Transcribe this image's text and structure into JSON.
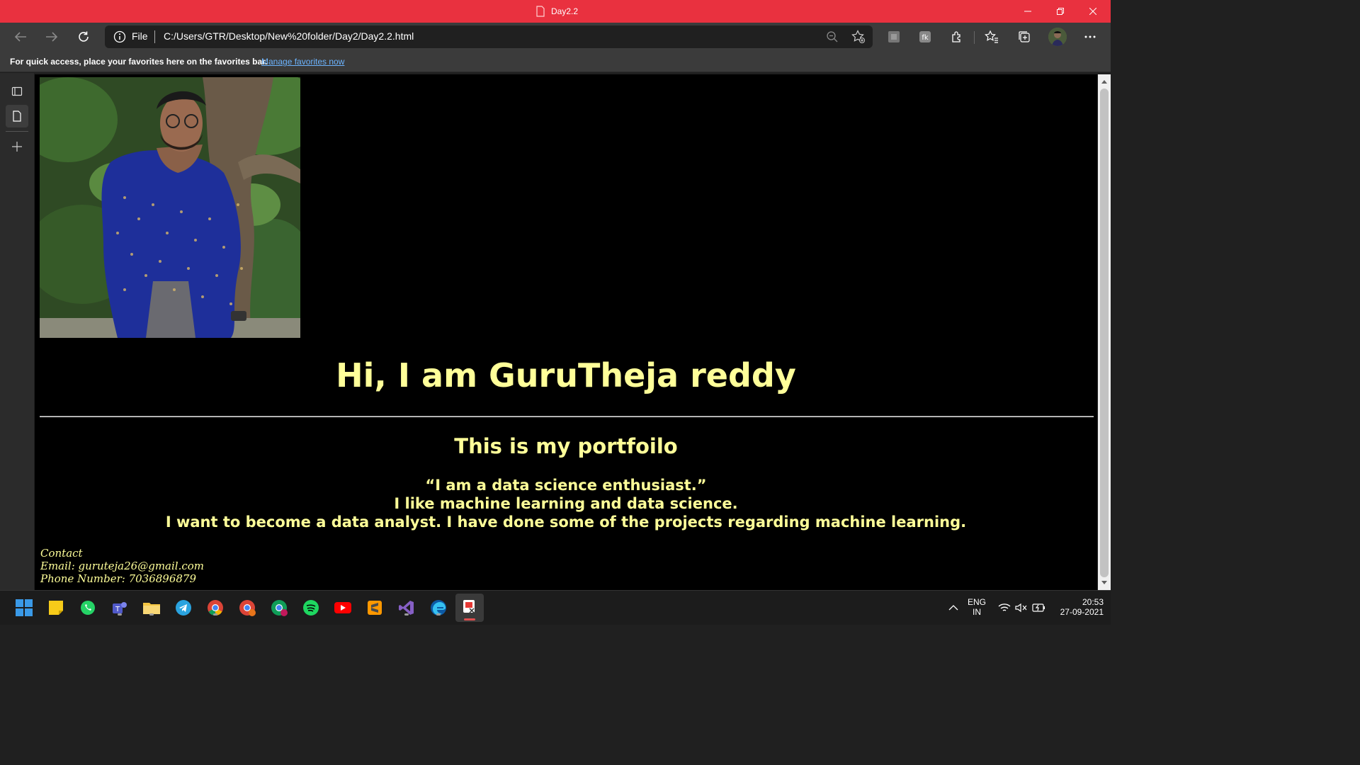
{
  "window": {
    "tab_title": "Day2.2",
    "controls": [
      "minimize",
      "restore",
      "close"
    ]
  },
  "toolbar": {
    "back_icon": "back-arrow-icon",
    "forward_icon": "forward-arrow-icon",
    "refresh_icon": "refresh-icon",
    "scheme_label": "File",
    "url": "C:/Users/GTR/Desktop/New%20folder/Day2/Day2.2.html"
  },
  "favorites_bar": {
    "message": "For quick access, place your favorites here on the favorites bar.",
    "link": "Manage favorites now"
  },
  "page": {
    "heading": "Hi, I am GuruTheja reddy",
    "subheading": "This is my portfoilo",
    "paragraph_lines": [
      "“I am a data science enthusiast.”",
      "I like machine learning and data science.",
      "I want to become a data analyst. I have done some of the projects regarding machine learning."
    ],
    "contact": {
      "title": "Contact",
      "email": "Email: guruteja26@gmail.com",
      "phone": "Phone Number: 7036896879"
    }
  },
  "taskbar": {
    "language_top": "ENG",
    "language_bottom": "IN",
    "time": "20:53",
    "date": "27-09-2021"
  },
  "colors": {
    "titlebar": "#e9313f",
    "page_text": "#ffff99",
    "page_background": "#000000",
    "link": "#6cb4ff"
  }
}
